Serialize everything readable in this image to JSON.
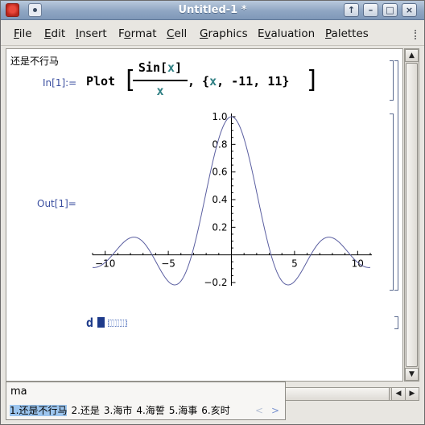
{
  "window": {
    "title": "Untitled-1 *",
    "controls": [
      "up-icon",
      "minimize-icon",
      "maximize-icon",
      "close-icon"
    ]
  },
  "menu": {
    "items": [
      {
        "label": "File",
        "u": "F"
      },
      {
        "label": "Edit",
        "u": "E"
      },
      {
        "label": "Insert",
        "u": "I"
      },
      {
        "label": "Format",
        "u": "o"
      },
      {
        "label": "Cell",
        "u": "C"
      },
      {
        "label": "Graphics",
        "u": "G"
      },
      {
        "label": "Evaluation",
        "u": "v"
      },
      {
        "label": "Palettes",
        "u": "P"
      }
    ]
  },
  "notebook": {
    "text_cell": "还是不行马",
    "in_label": "In[1]:=",
    "out_label": "Out[1]=",
    "input": {
      "head": "Plot",
      "numerator_fn": "Sin",
      "numerator_arg": "x",
      "denominator": "x",
      "range_open": ", {",
      "range_var": "x",
      "range_rest": ", -11, 11}"
    },
    "typing": "d"
  },
  "chart_data": {
    "type": "line",
    "title": "",
    "xlabel": "",
    "ylabel": "",
    "function": "Sin[x]/x",
    "xlim": [
      -11,
      11
    ],
    "ylim": [
      -0.2,
      1.0
    ],
    "xticks": [
      -10,
      -5,
      5,
      10
    ],
    "xtick_labels": [
      "−10",
      "−5",
      "5",
      "10"
    ],
    "yticks": [
      -0.2,
      0.2,
      0.4,
      0.6,
      0.8,
      1.0
    ],
    "ytick_labels": [
      "−0.2",
      "0.2",
      "0.4",
      "0.6",
      "0.8",
      "1.0"
    ],
    "series": [
      {
        "x": [
          -11,
          -10.5,
          -10,
          -9.5,
          -9,
          -8.5,
          -8,
          -7.5,
          -7,
          -6.5,
          -6,
          -5.5,
          -5,
          -4.5,
          -4,
          -3.5,
          -3,
          -2.5,
          -2,
          -1.5,
          -1,
          -0.5,
          0,
          0.5,
          1,
          1.5,
          2,
          2.5,
          3,
          3.5,
          4,
          4.5,
          5,
          5.5,
          6,
          6.5,
          7,
          7.5,
          8,
          8.5,
          9,
          9.5,
          10,
          10.5,
          11
        ],
        "y": [
          -0.091,
          -0.085,
          -0.054,
          -0.008,
          0.046,
          0.094,
          0.124,
          0.125,
          0.094,
          0.033,
          -0.047,
          -0.128,
          -0.192,
          -0.217,
          -0.189,
          -0.1,
          0.047,
          0.239,
          0.455,
          0.665,
          0.841,
          0.959,
          1.0,
          0.959,
          0.841,
          0.665,
          0.455,
          0.239,
          0.047,
          -0.1,
          -0.189,
          -0.217,
          -0.192,
          -0.128,
          -0.047,
          0.033,
          0.094,
          0.125,
          0.124,
          0.094,
          0.046,
          -0.008,
          -0.054,
          -0.085,
          -0.091
        ]
      }
    ],
    "line_color": "#5a5ea0"
  },
  "ime": {
    "input": "ma",
    "candidates": [
      "1.还是不行马",
      "2.还是",
      "3.海市",
      "4.海誓",
      "5.海事",
      "6.亥时"
    ],
    "selected": 0,
    "prev": "<",
    "next": ">"
  }
}
